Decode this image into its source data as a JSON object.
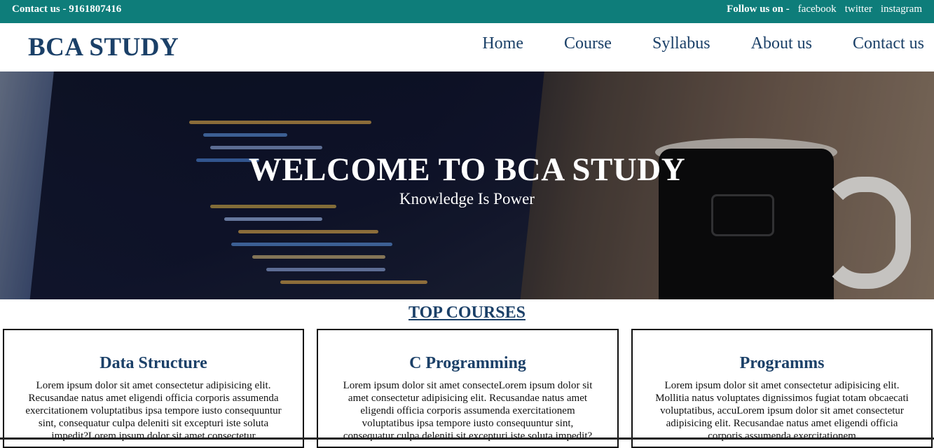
{
  "topbar": {
    "contact": "Contact us - 9161807416",
    "follow_label": "Follow us on -",
    "social": [
      "facebook",
      "twitter",
      "instagram"
    ]
  },
  "header": {
    "brand": "BCA STUDY",
    "nav": [
      "Home",
      "Course",
      "Syllabus",
      "About us",
      "Contact us"
    ]
  },
  "hero": {
    "title": "WELCOME TO BCA STUDY",
    "subtitle": "Knowledge Is Power"
  },
  "courses": {
    "title": "TOP COURSES",
    "items": [
      {
        "name": "Data Structure",
        "text": "Lorem ipsum dolor sit amet consectetur adipisicing elit. Recusandae natus amet eligendi officia corporis assumenda exercitationem voluptatibus ipsa tempore iusto consequuntur sint, consequatur culpa deleniti sit excepturi iste soluta impedit?Lorem ipsum dolor sit amet consectetur"
      },
      {
        "name": "C Programming",
        "text": "Lorem ipsum dolor sit amet consecteLorem ipsum dolor sit amet consectetur adipisicing elit. Recusandae natus amet eligendi officia corporis assumenda exercitationem voluptatibus ipsa tempore iusto consequuntur sint, consequatur culpa deleniti sit excepturi iste soluta impedit?"
      },
      {
        "name": "Programms",
        "text": "Lorem ipsum dolor sit amet consectetur adipisicing elit. Mollitia natus voluptates dignissimos fugiat totam obcaecati voluptatibus, accuLorem ipsum dolor sit amet consectetur adipisicing elit. Recusandae natus amet eligendi officia corporis assumenda exercitationem"
      }
    ]
  },
  "colors": {
    "topbar": "#0e7d7a",
    "brand": "#1b4068"
  }
}
